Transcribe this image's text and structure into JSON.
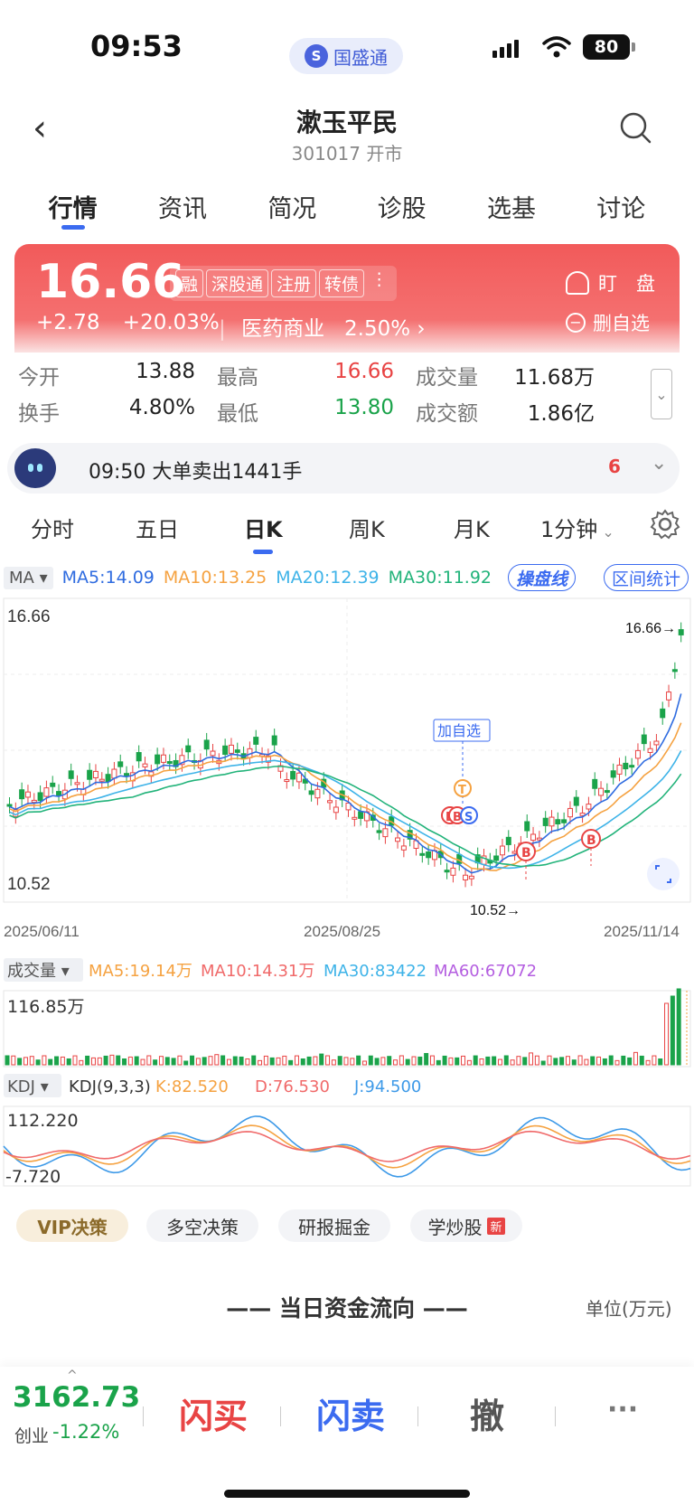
{
  "status": {
    "time": "09:53",
    "app_name": "国盛通",
    "battery": "80"
  },
  "nav": {
    "title": "漱玉平民",
    "subtitle": "301017 开市"
  },
  "main_tabs": [
    "行情",
    "资讯",
    "简况",
    "诊股",
    "选基",
    "讨论"
  ],
  "quote": {
    "price": "16.66",
    "badges": [
      "融",
      "深股通",
      "注册",
      "转债"
    ],
    "more": "⋮",
    "change": "+2.78",
    "change_pct": "+20.03%",
    "industry": "医药商业",
    "industry_pct": "2.50%",
    "industry_sep": "|",
    "chev": "›",
    "watch_label": "盯　盘",
    "remove_label": "删自选"
  },
  "stats": [
    {
      "label": "今开",
      "value": "13.88",
      "label2": "最高",
      "value2": "16.66",
      "label3": "成交量",
      "value3": "11.68万"
    },
    {
      "label": "换手",
      "value": "4.80%",
      "label2": "最低",
      "value2": "13.80",
      "label3": "成交额",
      "value3": "1.86亿"
    }
  ],
  "alert": {
    "text": "09:50 大单卖出1441手",
    "count": "6"
  },
  "chart_tabs": [
    "分时",
    "五日",
    "日K",
    "周K",
    "月K",
    "1分钟"
  ],
  "ma_legend": {
    "tag": "MA ▾",
    "ma5": "MA5:14.09",
    "ma10": "MA10:13.25",
    "ma20": "MA20:12.39",
    "ma30": "MA30:11.92",
    "btn1": "操盘线",
    "btn2": "区间统计"
  },
  "kline": {
    "high_label": "16.66",
    "low_label": "10.52",
    "high_mark": "16.66→",
    "low_mark": "10.52→",
    "date_start": "2025/06/11",
    "date_mid": "2025/08/25",
    "date_end": "2025/11/14",
    "add_watch_tag": "加自选",
    "signals": [
      "B",
      "B",
      "S",
      "B",
      "B",
      "T"
    ]
  },
  "volume": {
    "tag": "成交量 ▾",
    "ma5": "MA5:19.14万",
    "ma10": "MA10:14.31万",
    "ma30": "MA30:83422",
    "ma60": "MA60:67072",
    "max_label": "116.85万"
  },
  "kdj": {
    "tag": "KDJ ▾",
    "name": "KDJ(9,3,3)",
    "k": "K:82.520",
    "d": "D:76.530",
    "j": "J:94.500",
    "max_label": "112.220",
    "min_label": "-7.720"
  },
  "feature_tabs": [
    "VIP决策",
    "多空决策",
    "研报掘金",
    "学炒股"
  ],
  "new_badge": "新",
  "fund_flow": {
    "title": "—— 当日资金流向 ——",
    "unit": "单位(万元)"
  },
  "bottom": {
    "index_value": "3162.73",
    "index_name": "创业",
    "index_change": "-1.22%",
    "buy": "闪买",
    "sell": "闪卖",
    "cancel": "撤",
    "more": "···"
  },
  "colors": {
    "up": "#e84444",
    "down": "#1aa34a",
    "accent": "#3b6bf0",
    "ma5": "#2f6ce0",
    "ma10": "#f5a241",
    "ma20": "#3eb3e8",
    "ma30": "#22b37a",
    "kdj_k": "#f5a241",
    "kdj_d": "#f06a6a",
    "kdj_j": "#3e9ae8",
    "vol_ma60": "#b45ee0"
  }
}
